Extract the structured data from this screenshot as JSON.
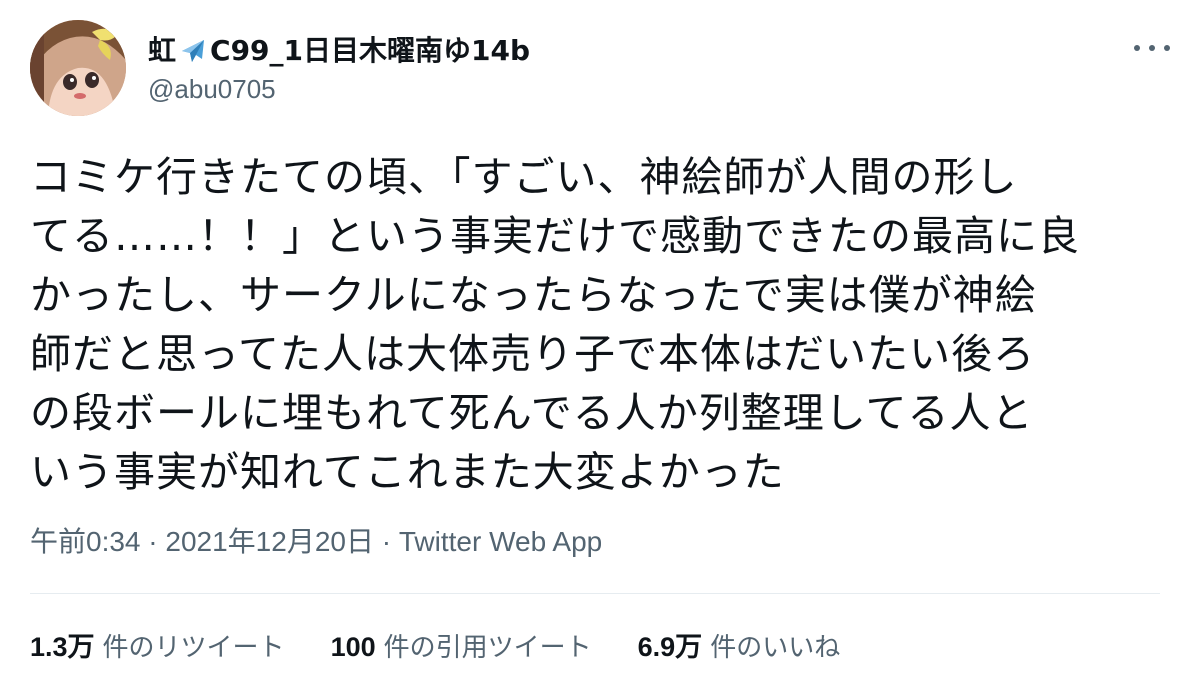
{
  "tweet": {
    "author": {
      "name_prefix": "虹",
      "name_suffix": "C99_1日目木曜南ゆ14b",
      "handle": "@abu0705"
    },
    "text": "コミケ行きたての頃、「すごい、神絵師が人間の形し\nてる……！！」という事実だけで感動できたの最高に良\nかったし、サークルになったらなったで実は僕が神絵\n師だと思ってた人は大体売り子で本体はだいたい後ろ\nの段ボールに埋もれて死んでる人か列整理してる人と\nいう事実が知れてこれまた大変よかった",
    "meta": {
      "time": "午前0:34",
      "separator": " · ",
      "date": "2021年12月20日",
      "separator2": " · ",
      "source": "Twitter Web App"
    },
    "stats": {
      "retweets": {
        "count": "1.3万",
        "label": "件のリツイート"
      },
      "quotes": {
        "count": "100",
        "label": "件の引用ツイート"
      },
      "likes": {
        "count": "6.9万",
        "label": "件のいいね"
      }
    }
  },
  "colors": {
    "text_primary": "#0f1419",
    "text_secondary": "#536471",
    "divider": "#e6ecf0",
    "plane": "#4a9fd8"
  },
  "icons": {
    "plane": "airplane-emoji-icon",
    "more": "more-horizontal-icon"
  }
}
